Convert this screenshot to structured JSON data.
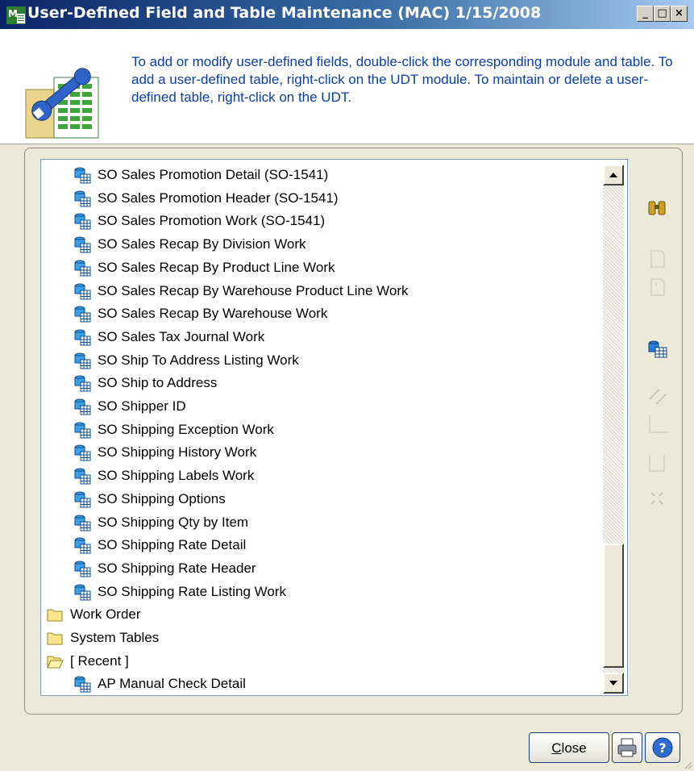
{
  "window": {
    "title": "User-Defined Field and Table Maintenance (MAC) 1/15/2008",
    "controls": [
      "minimize-icon",
      "maximize-icon",
      "close-icon"
    ]
  },
  "header": {
    "instructions": "To add or modify user-defined fields, double-click the corresponding module and table.  To add a user-defined table, right-click on the UDT module.  To maintain or delete a user-defined table, right-click on the UDT."
  },
  "tree": {
    "items": [
      {
        "label": "SO Sales Promotion Detail (SO-1541)",
        "type": "table",
        "level": 2
      },
      {
        "label": "SO Sales Promotion Header (SO-1541)",
        "type": "table",
        "level": 2
      },
      {
        "label": "SO Sales Promotion Work (SO-1541)",
        "type": "table",
        "level": 2
      },
      {
        "label": "SO Sales Recap By Division Work",
        "type": "table",
        "level": 2
      },
      {
        "label": "SO Sales Recap By Product Line Work",
        "type": "table",
        "level": 2
      },
      {
        "label": "SO Sales Recap By Warehouse Product Line Work",
        "type": "table",
        "level": 2
      },
      {
        "label": "SO Sales Recap By Warehouse Work",
        "type": "table",
        "level": 2
      },
      {
        "label": "SO Sales Tax Journal Work",
        "type": "table",
        "level": 2
      },
      {
        "label": "SO Ship To Address Listing Work",
        "type": "table",
        "level": 2
      },
      {
        "label": "SO Ship to Address",
        "type": "table",
        "level": 2
      },
      {
        "label": "SO Shipper ID",
        "type": "table",
        "level": 2
      },
      {
        "label": "SO Shipping Exception Work",
        "type": "table",
        "level": 2
      },
      {
        "label": "SO Shipping History Work",
        "type": "table",
        "level": 2
      },
      {
        "label": "SO Shipping Labels Work",
        "type": "table",
        "level": 2
      },
      {
        "label": "SO Shipping Options",
        "type": "table",
        "level": 2
      },
      {
        "label": "SO Shipping Qty by Item",
        "type": "table",
        "level": 2
      },
      {
        "label": "SO Shipping Rate Detail",
        "type": "table",
        "level": 2
      },
      {
        "label": "SO Shipping Rate Header",
        "type": "table",
        "level": 2
      },
      {
        "label": "SO Shipping Rate Listing Work",
        "type": "table",
        "level": 2
      },
      {
        "label": "Work Order",
        "type": "folder",
        "level": 1
      },
      {
        "label": "System Tables",
        "type": "folder",
        "level": 1
      },
      {
        "label": "[ Recent ]",
        "type": "folder-open",
        "level": 1
      },
      {
        "label": "AP Manual Check Detail",
        "type": "table",
        "level": 2
      }
    ]
  },
  "toolbar": {
    "tools": [
      {
        "icon": "binoculars-icon",
        "enabled": true
      },
      {
        "icon": "new-icon",
        "enabled": false
      },
      {
        "icon": "edit-icon",
        "enabled": false
      },
      {
        "icon": "table-icon",
        "enabled": true
      },
      {
        "icon": "rename-icon",
        "enabled": false
      },
      {
        "icon": "copy-icon",
        "enabled": false
      },
      {
        "icon": "paste-icon",
        "enabled": false
      },
      {
        "icon": "delete-icon",
        "enabled": false
      }
    ]
  },
  "buttons": {
    "close_label": "Close",
    "print_icon": "printer-icon",
    "help_icon": "help-icon"
  }
}
